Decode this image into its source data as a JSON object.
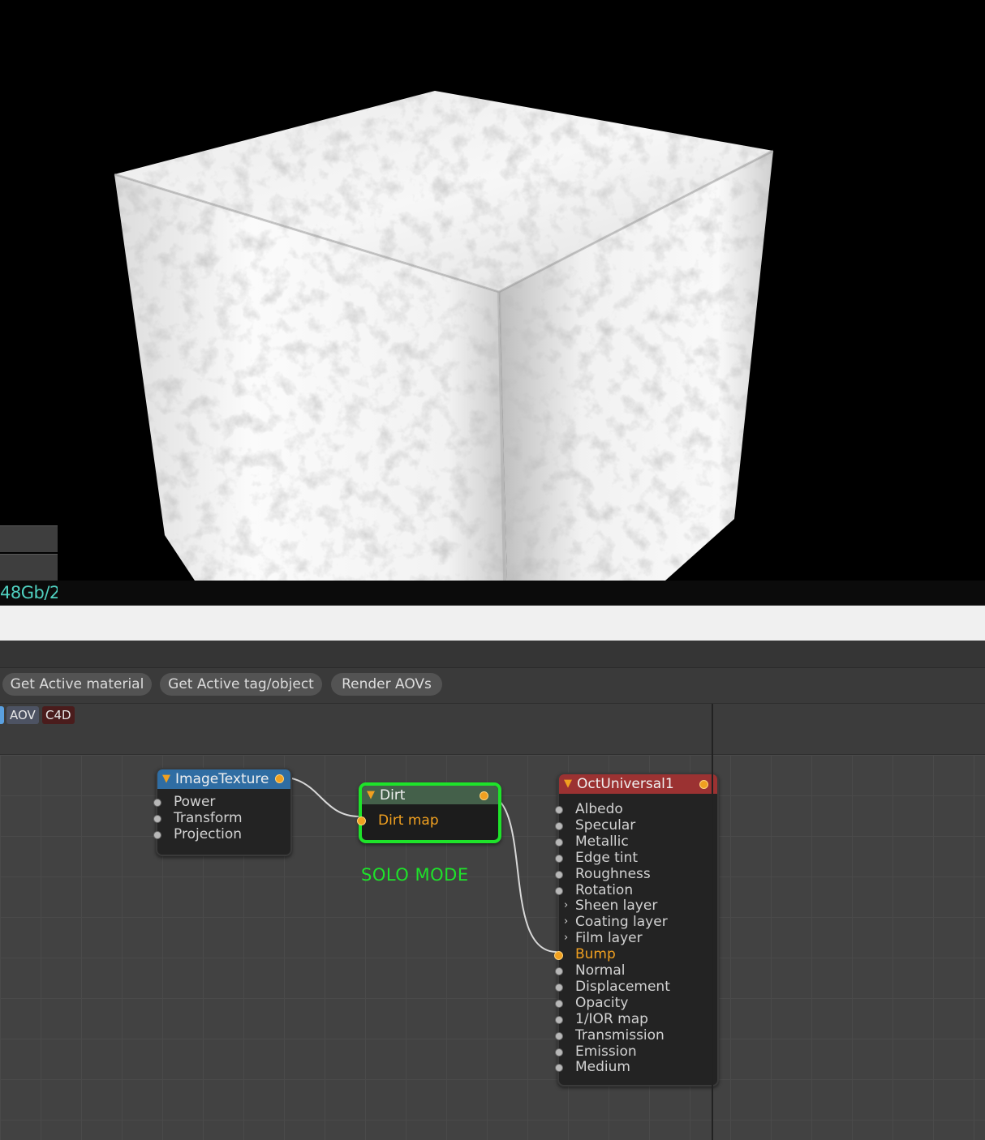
{
  "status": {
    "memory_text": "48Gb/2"
  },
  "toolbar": {
    "buttons": [
      "Get Active material",
      "Get Active tag/object",
      "Render AOVs"
    ]
  },
  "tags": {
    "aov": "AOV",
    "c4d": "C4D"
  },
  "solo_label": "SOLO MODE",
  "nodes": {
    "image_texture": {
      "title": "ImageTexture",
      "pins": [
        "Power",
        "Transform",
        "Projection"
      ]
    },
    "dirt": {
      "title": "Dirt",
      "pins": [
        "Dirt map"
      ]
    },
    "oct_universal": {
      "title": "OctUniversal1",
      "pins": [
        "Albedo",
        "Specular",
        "Metallic",
        "Edge tint",
        "Roughness",
        "Rotation",
        "Sheen layer",
        "Coating layer",
        "Film layer",
        "Bump",
        "Normal",
        "Displacement",
        "Opacity",
        "1/IOR map",
        "Transmission",
        "Emission",
        "Medium"
      ],
      "group_pins": [
        "Sheen layer",
        "Coating layer",
        "Film layer"
      ],
      "connected_pin": "Bump"
    }
  },
  "colors": {
    "solo_outline": "#1ee32a",
    "image_texture_header": "#2f6da3",
    "dirt_header": "#44604a",
    "oct_header": "#9b3232",
    "port_active": "#f0a020"
  }
}
